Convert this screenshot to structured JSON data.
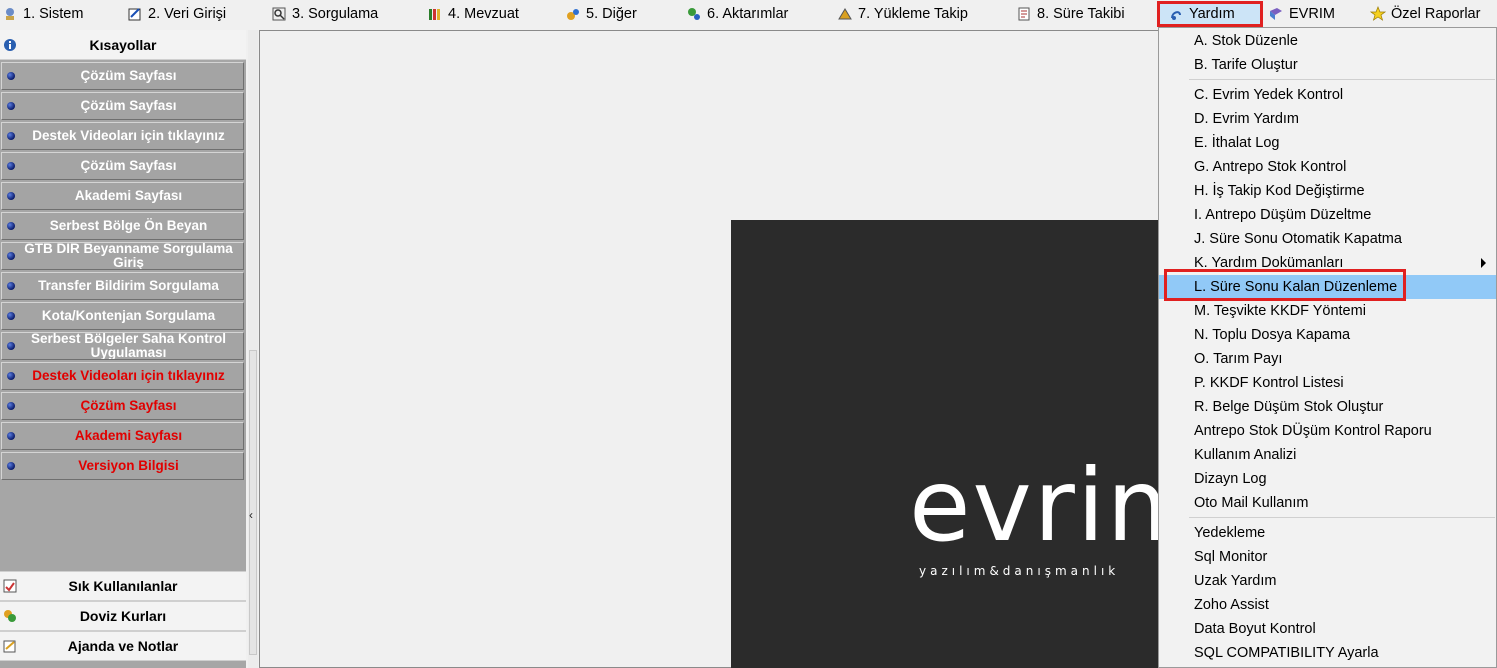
{
  "menubar": {
    "items": [
      {
        "label": "1.  Sistem",
        "icon": "system-icon"
      },
      {
        "label": "2.  Veri Girişi",
        "icon": "data-entry-icon"
      },
      {
        "label": "3.  Sorgulama",
        "icon": "query-icon"
      },
      {
        "label": "4.  Mevzuat",
        "icon": "legislation-icon"
      },
      {
        "label": "5.  Diğer",
        "icon": "other-icon"
      },
      {
        "label": "6.  Aktarımlar",
        "icon": "transfer-icon"
      },
      {
        "label": "7.  Yükleme Takip",
        "icon": "upload-tracking-icon"
      },
      {
        "label": "8. Süre Takibi",
        "icon": "time-tracking-icon"
      },
      {
        "label": "Yardım",
        "icon": "help-icon"
      },
      {
        "label": "EVRIM",
        "icon": "evrim-icon"
      },
      {
        "label": "Özel Raporlar",
        "icon": "star-icon"
      }
    ]
  },
  "sidebar": {
    "header": "Kısayollar",
    "items": [
      {
        "label": "Çözüm Sayfası"
      },
      {
        "label": "Çözüm Sayfası"
      },
      {
        "label": "Destek Videoları için tıklayınız"
      },
      {
        "label": "Çözüm Sayfası"
      },
      {
        "label": "Akademi Sayfası"
      },
      {
        "label": "Serbest Bölge Ön Beyan"
      },
      {
        "label": "GTB DIR Beyanname Sorgulama Giriş"
      },
      {
        "label": "Transfer Bildirim Sorgulama"
      },
      {
        "label": "Kota/Kontenjan Sorgulama"
      },
      {
        "label": "Serbest Bölgeler Saha Kontrol Uygulaması"
      },
      {
        "label": "Destek Videoları için tıklayınız"
      },
      {
        "label": "Çözüm Sayfası"
      },
      {
        "label": "Akademi Sayfası"
      },
      {
        "label": "Versiyon Bilgisi"
      }
    ],
    "bottom": [
      "Sık Kullanılanlar",
      "Doviz Kurları",
      "Ajanda ve Notlar"
    ]
  },
  "logo": {
    "word": "evrim",
    "subtitle": "yazılım&danışmanlık"
  },
  "dropdown": {
    "items": [
      {
        "label": "A.   Stok Düzenle"
      },
      {
        "label": "B.   Tarife Oluştur"
      },
      {
        "label": "C.   Evrim Yedek Kontrol"
      },
      {
        "label": "D.   Evrim Yardım"
      },
      {
        "label": "E.   İthalat Log"
      },
      {
        "label": "G.   Antrepo Stok Kontrol"
      },
      {
        "label": "H.  İş Takip Kod Değiştirme"
      },
      {
        "label": "I.    Antrepo Düşüm Düzeltme"
      },
      {
        "label": "J.   Süre Sonu Otomatik Kapatma"
      },
      {
        "label": "K.   Yardım Dokümanları"
      },
      {
        "label": "L. Süre Sonu Kalan Düzenleme"
      },
      {
        "label": "M. Teşvikte KKDF Yöntemi"
      },
      {
        "label": "N. Toplu Dosya Kapama"
      },
      {
        "label": "O. Tarım Payı"
      },
      {
        "label": "P. KKDF Kontrol Listesi"
      },
      {
        "label": "R. Belge Düşüm Stok Oluştur"
      },
      {
        "label": "Antrepo Stok DÜşüm Kontrol Raporu"
      },
      {
        "label": "Kullanım Analizi"
      },
      {
        "label": "Dizayn Log"
      },
      {
        "label": "Oto Mail Kullanım"
      },
      {
        "label": "Yedekleme"
      },
      {
        "label": "Sql Monitor"
      },
      {
        "label": "Uzak Yardım"
      },
      {
        "label": "Zoho Assist"
      },
      {
        "label": "Data Boyut Kontrol"
      },
      {
        "label": "SQL COMPATIBILITY Ayarla"
      }
    ]
  },
  "colors": {
    "highlight": "#91c9f7",
    "annotation": "#e02020",
    "sidebar_red_text": "#e10000"
  }
}
